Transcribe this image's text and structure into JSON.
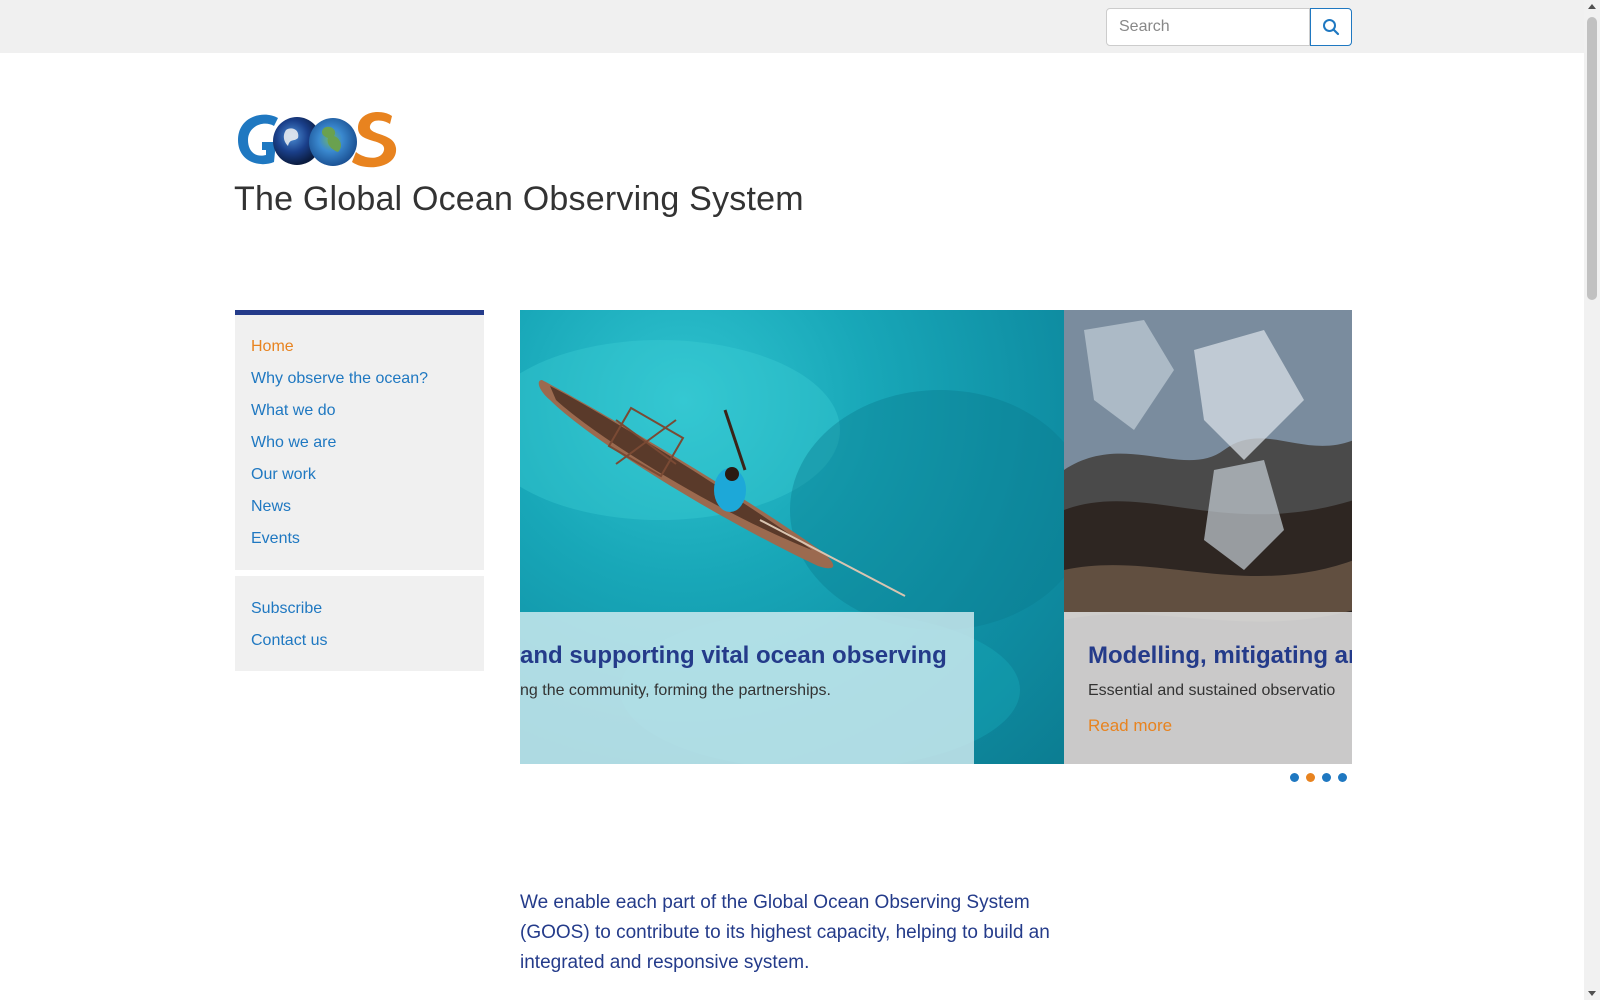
{
  "search": {
    "placeholder": "Search"
  },
  "header": {
    "site_title": "The Global Ocean Observing System"
  },
  "colors": {
    "accent_blue": "#1f78c1",
    "brand_navy": "#243b8a",
    "accent_orange": "#e8831f"
  },
  "nav": {
    "items": [
      {
        "label": "Home"
      },
      {
        "label": "Why observe the ocean?"
      },
      {
        "label": "What we do"
      },
      {
        "label": "Who we are"
      },
      {
        "label": "Our work"
      },
      {
        "label": "News"
      },
      {
        "label": "Events"
      }
    ],
    "secondary": [
      {
        "label": "Subscribe"
      },
      {
        "label": "Contact us"
      }
    ]
  },
  "carousel": {
    "slides": [
      {
        "title": "and supporting vital ocean observing",
        "text": "ng the community, forming the partnerships."
      },
      {
        "title": "Modelling, mitigating ar",
        "text": "Essential and sustained observatio",
        "link": "Read more"
      }
    ]
  },
  "intro": {
    "text": "We enable each part of the Global Ocean Observing System (GOOS) to contribute to its highest capacity, helping to build an integrated and responsive system."
  }
}
